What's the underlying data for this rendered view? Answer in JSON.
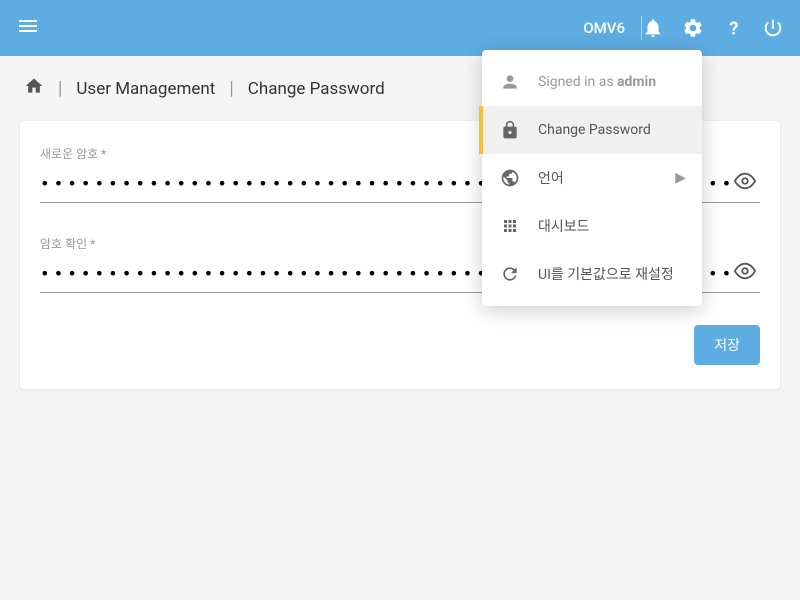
{
  "header": {
    "title": "OMV6"
  },
  "breadcrumb": {
    "item1": "User Management",
    "item2": "Change Password"
  },
  "form": {
    "newPassword": {
      "label": "새로운 암호 *",
      "value": "••••••••••••••••••••••••••••••••••••••••••••••••••••••••••••••••••••"
    },
    "confirmPassword": {
      "label": "암호 확인 *",
      "value": "••••••••••••••••••••••••••••••••••••••••••••••••••••••••••••••••••••"
    },
    "saveButton": "저장"
  },
  "menu": {
    "signedInPrefix": "Signed in as ",
    "signedInUser": "admin",
    "changePassword": "Change Password",
    "language": "언어",
    "dashboard": "대시보드",
    "resetUI": "UI를 기본값으로 재설정"
  }
}
